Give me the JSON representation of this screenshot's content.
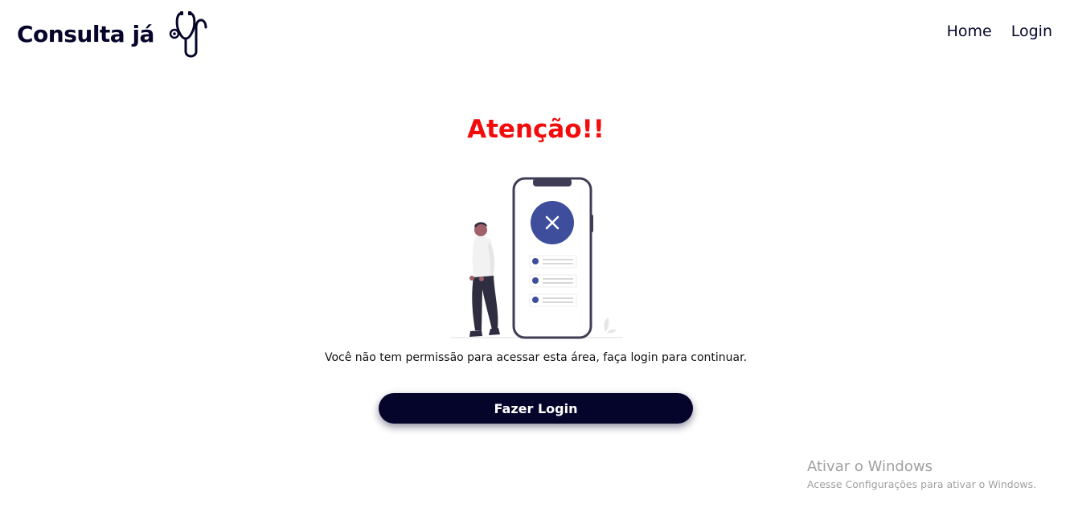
{
  "header": {
    "brand_title": "Consulta já",
    "brand_icon": "stethoscope-icon",
    "nav": [
      {
        "label": "Home"
      },
      {
        "label": "Login"
      }
    ]
  },
  "main": {
    "title": "Atenção!!",
    "illustration_icon": "access-denied-illustration",
    "message": "Você não tem permissão para acessar esta área, faça login para continuar.",
    "login_button_label": "Fazer Login"
  },
  "watermark": {
    "title": "Ativar o Windows",
    "subtitle": "Acesse Configurações para ativar o Windows."
  },
  "colors": {
    "brand_dark": "#05052b",
    "alert_red": "#f20c0c",
    "illustration_accent": "#3f4e9c"
  }
}
